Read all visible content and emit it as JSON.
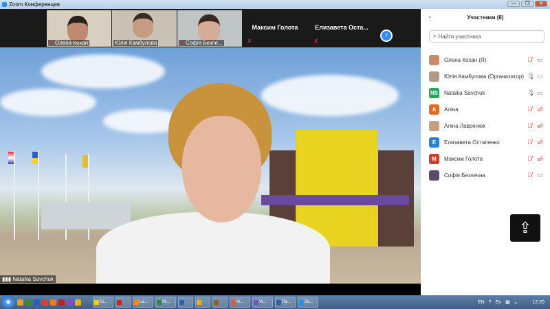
{
  "window": {
    "title": "Zoom Конференция",
    "buttons": [
      "—",
      "❐",
      "✕"
    ]
  },
  "thumbnails": [
    {
      "name": "Олена Кохан",
      "muted": true
    },
    {
      "name": "Юлія  Камбулова",
      "muted": false
    },
    {
      "name": "Софія Безпе...",
      "muted": true
    },
    {
      "name": "Максим Голота",
      "muted": true
    },
    {
      "name": "Елизавета  Оста...",
      "muted": true
    }
  ],
  "next_arrow": "›",
  "main_video": {
    "speaker": "Nataliia Savchuk"
  },
  "panel": {
    "title": "Участники (8)",
    "search_placeholder": "Найти участника",
    "participants": [
      {
        "name": "Олена Кохан (Я)",
        "initials": "",
        "color": "#c98b6b",
        "mic": "muted",
        "video": "on"
      },
      {
        "name": "Юлія  Камбулова (Организатор)",
        "initials": "",
        "color": "#b09a84",
        "mic": "on",
        "video": "on"
      },
      {
        "name": "Nataliia Savchuk",
        "initials": "NS",
        "color": "#23a55a",
        "mic": "on",
        "video": "on"
      },
      {
        "name": "Аліна",
        "initials": "A",
        "color": "#e06c1f",
        "mic": "muted",
        "video": "off"
      },
      {
        "name": "Аліна Лавренюк",
        "initials": "",
        "color": "#c4a07e",
        "mic": "muted",
        "video": "off"
      },
      {
        "name": "Елизавета Остапенко",
        "initials": "E",
        "color": "#2a7fd4",
        "mic": "muted",
        "video": "off"
      },
      {
        "name": "Максим Голота",
        "initials": "M",
        "color": "#d33b2c",
        "mic": "muted",
        "video": "off"
      },
      {
        "name": "Софія Безпечна",
        "initials": "",
        "color": "#5b4a6b",
        "mic": "muted",
        "video": "on"
      }
    ]
  },
  "taskbar": {
    "buttons": [
      {
        "label": "D\\...",
        "color": "#e8c840"
      },
      {
        "label": "",
        "color": "#d02020"
      },
      {
        "label": "La...",
        "color": "#f08a20"
      },
      {
        "label": "Mi...",
        "color": "#2a8a3a"
      },
      {
        "label": "",
        "color": "#2b5fb4"
      },
      {
        "label": "",
        "color": "#e8b020"
      },
      {
        "label": "",
        "color": "#8a6030"
      },
      {
        "label": "M...",
        "color": "#e05a30"
      },
      {
        "label": "Vi...",
        "color": "#7a50c0"
      },
      {
        "label": "Па...",
        "color": "#3060a0"
      },
      {
        "label": "Zo...",
        "color": "#2d8cff"
      }
    ],
    "lang": "EN",
    "lang2": "En",
    "clock": "12:20"
  }
}
